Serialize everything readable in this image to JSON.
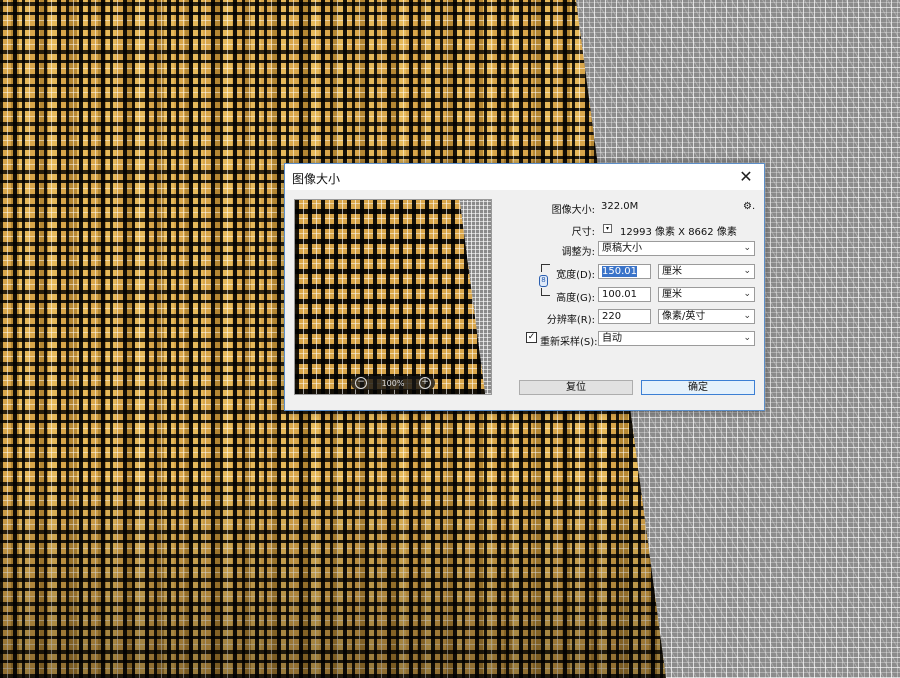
{
  "dialog": {
    "title": "图像大小",
    "close_glyph": "✕",
    "preview": {
      "zoom": "100%",
      "zoom_out": "−",
      "zoom_in": "+"
    },
    "image_size": {
      "label": "图像大小:",
      "value": "322.0M"
    },
    "gear_glyph": "⚙.",
    "dimensions": {
      "label": "尺寸:",
      "value": "12993 像素  X  8662 像素",
      "toggle_glyph": "▾"
    },
    "fit_to": {
      "label": "调整为:",
      "value": "原稿大小"
    },
    "width": {
      "label": "宽度(D):",
      "value": "150.01",
      "unit": "厘米"
    },
    "height": {
      "label": "高度(G):",
      "value": "100.01",
      "unit": "厘米"
    },
    "resolution": {
      "label": "分辨率(R):",
      "value": "220",
      "unit": "像素/英寸"
    },
    "resample": {
      "label": "重新采样(S):",
      "checked_glyph": "✓",
      "value": "自动"
    },
    "link_glyph": "8",
    "buttons": {
      "reset": "复位",
      "ok": "确定"
    },
    "dropdown_arrow": "⌄"
  }
}
